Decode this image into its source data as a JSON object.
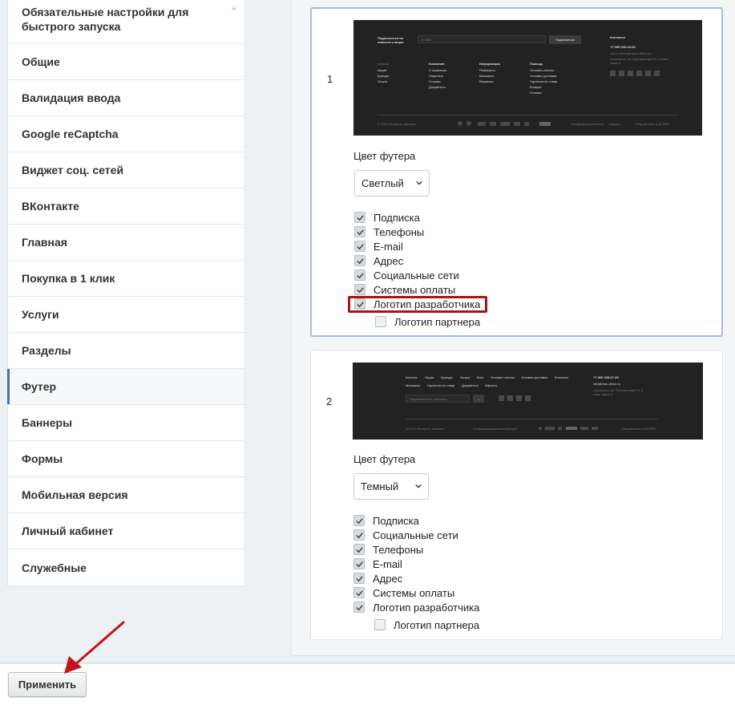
{
  "sidebar": {
    "items": [
      {
        "label": "Обязательные настройки для быстрого запуска"
      },
      {
        "label": "Общие"
      },
      {
        "label": "Валидация ввода"
      },
      {
        "label": "Google reCaptcha"
      },
      {
        "label": "Виджет соц. сетей"
      },
      {
        "label": "ВКонтакте"
      },
      {
        "label": "Главная"
      },
      {
        "label": "Покупка в 1 клик"
      },
      {
        "label": "Услуги"
      },
      {
        "label": "Разделы"
      },
      {
        "label": "Футер"
      },
      {
        "label": "Баннеры"
      },
      {
        "label": "Формы"
      },
      {
        "label": "Мобильная версия"
      },
      {
        "label": "Личный кабинет"
      },
      {
        "label": "Служебные"
      }
    ],
    "first_item_star": "*",
    "active_item": "Футер"
  },
  "footer_variants": [
    {
      "number": "1",
      "color_label": "Цвет футера",
      "color_value": "Светлый",
      "options": [
        {
          "label": "Подписка",
          "checked": true
        },
        {
          "label": "Телефоны",
          "checked": true
        },
        {
          "label": "E-mail",
          "checked": true
        },
        {
          "label": "Адрес",
          "checked": true
        },
        {
          "label": "Социальные сети",
          "checked": true
        },
        {
          "label": "Системы оплаты",
          "checked": true
        },
        {
          "label": "Логотип разработчика",
          "checked": true,
          "highlighted": true
        },
        {
          "label": "Логотип партнера",
          "checked": false
        }
      ],
      "preview": {
        "subscribe_title": "Подписаться на новости и акции",
        "email_placeholder": "E-mail",
        "subscribe_button": "Подписаться",
        "contacts_title": "Контакты",
        "phone": "+7 999 000-00-00",
        "email": "aspro-demo@aspro-demo.ru",
        "address": "Челябинск, ул. Ворошилова 23, 3 этаж, офис 3",
        "columns": [
          {
            "title": "Компания",
            "links": [
              "О компании",
              "Лицензии",
              "Отзывы",
              "Документы"
            ]
          },
          {
            "title": "Информация",
            "links": [
              "Реквизиты",
              "Магазины",
              "Вакансии"
            ]
          },
          {
            "title": "Помощь",
            "links": [
              "Условия оплаты",
              "Условия доставки",
              "Гарантия на товар",
              "Возврат",
              "Отзывы"
            ]
          }
        ],
        "catalog_links": [
          "Каталог",
          "Акции",
          "Бренды",
          "Услуги"
        ],
        "copyright": "© 2023 Интернет-магазин",
        "policy_links": [
          "Конфиденциальность",
          "Оферта"
        ],
        "developer": "Разработано в АСПРО"
      }
    },
    {
      "number": "2",
      "color_label": "Цвет футера",
      "color_value": "Темный",
      "options": [
        {
          "label": "Подписка",
          "checked": true
        },
        {
          "label": "Социальные сети",
          "checked": true
        },
        {
          "label": "Телефоны",
          "checked": true
        },
        {
          "label": "E-mail",
          "checked": true
        },
        {
          "label": "Адрес",
          "checked": true
        },
        {
          "label": "Системы оплаты",
          "checked": true
        },
        {
          "label": "Логотип разработчика",
          "checked": true
        },
        {
          "label": "Логотип партнера",
          "checked": false
        }
      ],
      "preview": {
        "menu_row1": [
          "Каталог",
          "Акции",
          "Бренды",
          "Услуги",
          "Блог",
          "Условия оплаты",
          "Условия доставки",
          "Контакты"
        ],
        "menu_row2": [
          "Магазины",
          "Гарантия на товар",
          "Документы",
          "Оферта"
        ],
        "email_placeholder": "Подписаться на рассылку",
        "phone": "+7 900 345-67-89",
        "email": "info@max-demo.ru",
        "address": "Челябинск, ул. Ворошилова 23, 3 этаж, офис 4",
        "copyright": "2023 © Интернет-магазин",
        "policy_links": [
          "Конфиденциальность",
          "Оферта"
        ],
        "developer": "Разработано в АСПРО"
      }
    }
  ],
  "actions": {
    "apply_label": "Применить"
  },
  "colors": {
    "highlight": "#a81313",
    "active_card_border": "#a4bde2",
    "arrow": "#c0151d"
  }
}
